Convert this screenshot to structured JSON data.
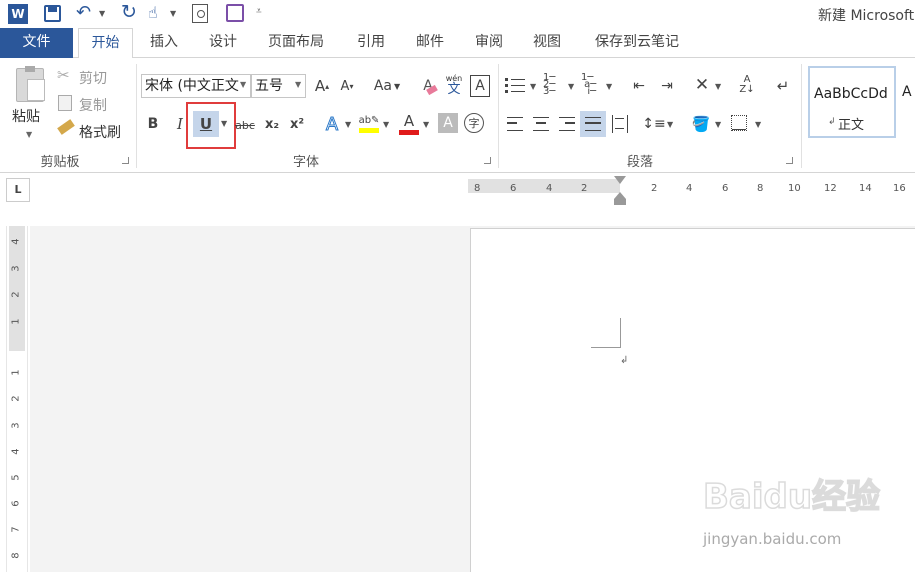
{
  "title": {
    "doc": "新建 Microsoft"
  },
  "tabs": [
    {
      "id": "file",
      "label": "文件"
    },
    {
      "id": "home",
      "label": "开始"
    },
    {
      "id": "insert",
      "label": "插入"
    },
    {
      "id": "design",
      "label": "设计"
    },
    {
      "id": "layout",
      "label": "页面布局"
    },
    {
      "id": "refs",
      "label": "引用"
    },
    {
      "id": "mail",
      "label": "邮件"
    },
    {
      "id": "review",
      "label": "审阅"
    },
    {
      "id": "view",
      "label": "视图"
    },
    {
      "id": "cloud",
      "label": "保存到云笔记"
    }
  ],
  "clipboard": {
    "paste": "粘贴",
    "cut": "剪切",
    "copy": "复制",
    "format_painter": "格式刷",
    "group": "剪贴板"
  },
  "font": {
    "name": "宋体 (中文正文",
    "size": "五号",
    "group": "字体",
    "phonetic": "wén",
    "phonetic_char": "文",
    "bold": "B",
    "italic": "I",
    "underline": "U",
    "strike": "abc",
    "sub": "x₂",
    "sup": "x²",
    "aa": "Aa",
    "color_a": "A",
    "enclose": "字"
  },
  "paragraph": {
    "group": "段落"
  },
  "styles": {
    "sample": "AaBbCcDd",
    "name": "正文",
    "next": "A"
  },
  "ruler": {
    "h_ticks": [
      "8",
      "6",
      "4",
      "2",
      "2",
      "4",
      "6",
      "8",
      "10",
      "12",
      "14",
      "16"
    ],
    "v_ticks_top": [
      "4",
      "3",
      "2",
      "1"
    ],
    "v_ticks_bottom": [
      "1",
      "2",
      "3",
      "4",
      "5",
      "6",
      "7",
      "8"
    ]
  },
  "ruler_corner": "L",
  "highlight_color": "#e03c3c",
  "accent": "#2b579a",
  "watermark": {
    "brand": "Baidu经验",
    "url": "jingyan.baidu.com"
  }
}
